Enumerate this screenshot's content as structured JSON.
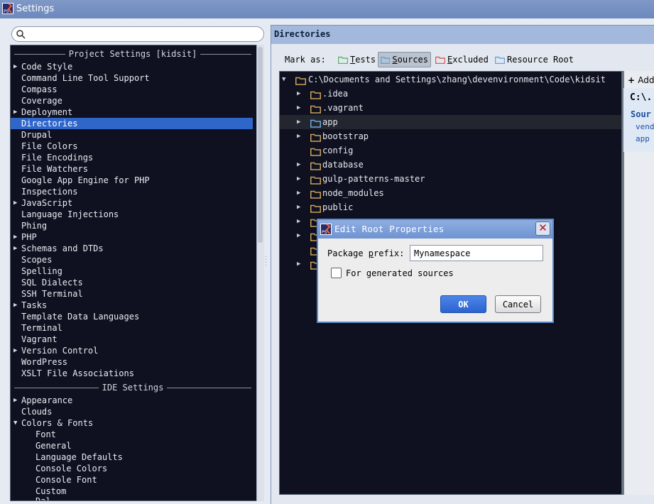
{
  "window": {
    "title": "Settings"
  },
  "search": {
    "value": "",
    "placeholder": ""
  },
  "tree": {
    "project_header": "Project Settings [kidsit]",
    "ide_header": "IDE Settings",
    "items": [
      {
        "label": "Code Style",
        "expandable": true,
        "level": 0
      },
      {
        "label": "Command Line Tool Support",
        "expandable": false,
        "level": 0
      },
      {
        "label": "Compass",
        "expandable": false,
        "level": 0
      },
      {
        "label": "Coverage",
        "expandable": false,
        "level": 0
      },
      {
        "label": "Deployment",
        "expandable": true,
        "level": 0
      },
      {
        "label": "Directories",
        "expandable": false,
        "level": 0,
        "selected": true
      },
      {
        "label": "Drupal",
        "expandable": false,
        "level": 0
      },
      {
        "label": "File Colors",
        "expandable": false,
        "level": 0
      },
      {
        "label": "File Encodings",
        "expandable": false,
        "level": 0
      },
      {
        "label": "File Watchers",
        "expandable": false,
        "level": 0
      },
      {
        "label": "Google App Engine for PHP",
        "expandable": false,
        "level": 0
      },
      {
        "label": "Inspections",
        "expandable": false,
        "level": 0
      },
      {
        "label": "JavaScript",
        "expandable": true,
        "level": 0
      },
      {
        "label": "Language Injections",
        "expandable": false,
        "level": 0
      },
      {
        "label": "Phing",
        "expandable": false,
        "level": 0
      },
      {
        "label": "PHP",
        "expandable": true,
        "level": 0
      },
      {
        "label": "Schemas and DTDs",
        "expandable": true,
        "level": 0
      },
      {
        "label": "Scopes",
        "expandable": false,
        "level": 0
      },
      {
        "label": "Spelling",
        "expandable": false,
        "level": 0
      },
      {
        "label": "SQL Dialects",
        "expandable": false,
        "level": 0
      },
      {
        "label": "SSH Terminal",
        "expandable": false,
        "level": 0
      },
      {
        "label": "Tasks",
        "expandable": true,
        "level": 0
      },
      {
        "label": "Template Data Languages",
        "expandable": false,
        "level": 0
      },
      {
        "label": "Terminal",
        "expandable": false,
        "level": 0
      },
      {
        "label": "Vagrant",
        "expandable": false,
        "level": 0
      },
      {
        "label": "Version Control",
        "expandable": true,
        "level": 0
      },
      {
        "label": "WordPress",
        "expandable": false,
        "level": 0
      },
      {
        "label": "XSLT File Associations",
        "expandable": false,
        "level": 0
      }
    ],
    "ide_items": [
      {
        "label": "Appearance",
        "expandable": true,
        "expanded": false,
        "level": 0
      },
      {
        "label": "Clouds",
        "expandable": false,
        "level": 0
      },
      {
        "label": "Colors & Fonts",
        "expandable": true,
        "expanded": true,
        "level": 0
      },
      {
        "label": "Font",
        "expandable": false,
        "level": 1
      },
      {
        "label": "General",
        "expandable": false,
        "level": 1
      },
      {
        "label": "Language Defaults",
        "expandable": false,
        "level": 1
      },
      {
        "label": "Console Colors",
        "expandable": false,
        "level": 1
      },
      {
        "label": "Console Font",
        "expandable": false,
        "level": 1
      },
      {
        "label": "Custom",
        "expandable": false,
        "level": 1
      }
    ]
  },
  "panel": {
    "title": "Directories",
    "mark_as_label": "Mark as:",
    "mark_buttons": [
      {
        "label": "Tests",
        "mnemonic": "T",
        "color": "#5fb56a"
      },
      {
        "label": "Sources",
        "mnemonic": "S",
        "color": "#5d9fdc",
        "pressed": true
      },
      {
        "label": "Excluded",
        "mnemonic": "E",
        "color": "#d8605a"
      },
      {
        "label": "Resource Root",
        "mnemonic": "",
        "color": "#6aa4d8"
      }
    ]
  },
  "dirs": {
    "root": "C:\\Documents and Settings\\zhang\\devenvironment\\Code\\kidsit",
    "children": [
      {
        "name": ".idea",
        "expandable": true
      },
      {
        "name": ".vagrant",
        "expandable": true
      },
      {
        "name": "app",
        "expandable": true,
        "source": true
      },
      {
        "name": "bootstrap",
        "expandable": true
      },
      {
        "name": "config",
        "expandable": false
      },
      {
        "name": "database",
        "expandable": true
      },
      {
        "name": "gulp-patterns-master",
        "expandable": true
      },
      {
        "name": "node_modules",
        "expandable": true
      },
      {
        "name": "public",
        "expandable": true
      },
      {
        "name": "",
        "expandable": true
      },
      {
        "name": "",
        "expandable": true
      },
      {
        "name": "",
        "expandable": false
      },
      {
        "name": "",
        "expandable": true
      }
    ]
  },
  "roots": {
    "add_label": "Add",
    "path": "C:\\.",
    "source_header": "Sour",
    "entries": [
      "vend",
      "app"
    ]
  },
  "dialog": {
    "title": "Edit Root Properties",
    "package_prefix_label": "Package prefix:",
    "package_prefix_value": "Mynamespace",
    "generated_label": "For generated sources",
    "generated_checked": false,
    "ok_label": "OK",
    "cancel_label": "Cancel"
  },
  "colors": {
    "folder": "#c9a25b",
    "source_folder": "#6aa8d8",
    "accent": "#2f66c9"
  }
}
